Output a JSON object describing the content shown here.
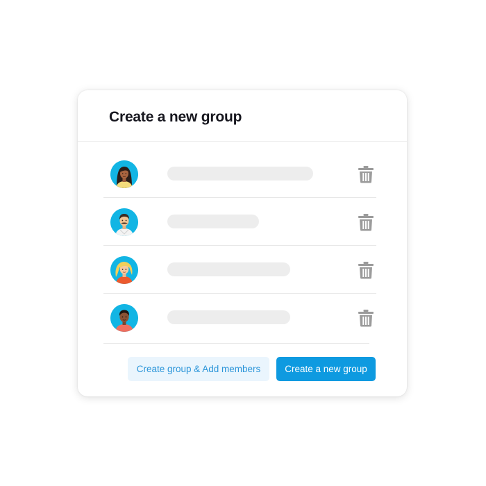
{
  "dialog": {
    "title": "Create a new group"
  },
  "members": [
    {
      "avatar_icon": "avatar-woman-long-hair-icon",
      "name_placeholder": "name-placeholder-bar"
    },
    {
      "avatar_icon": "avatar-man-mustache-icon",
      "name_placeholder": "name-placeholder-bar"
    },
    {
      "avatar_icon": "avatar-woman-blonde-icon",
      "name_placeholder": "name-placeholder-bar"
    },
    {
      "avatar_icon": "avatar-man-dark-hair-icon",
      "name_placeholder": "name-placeholder-bar"
    }
  ],
  "member_row_icons": {
    "remove": "trash-icon"
  },
  "buttons": {
    "secondary_label": "Create group & Add members",
    "primary_label": "Create a new group"
  },
  "colors": {
    "accent": "#0e9ae0",
    "secondary_button_bg": "#eaf5fd",
    "secondary_button_text": "#2b95d9",
    "avatar_bg": "#12b5e4",
    "trash_icon": "#9b9b9b",
    "placeholder_bar": "#ededed"
  }
}
